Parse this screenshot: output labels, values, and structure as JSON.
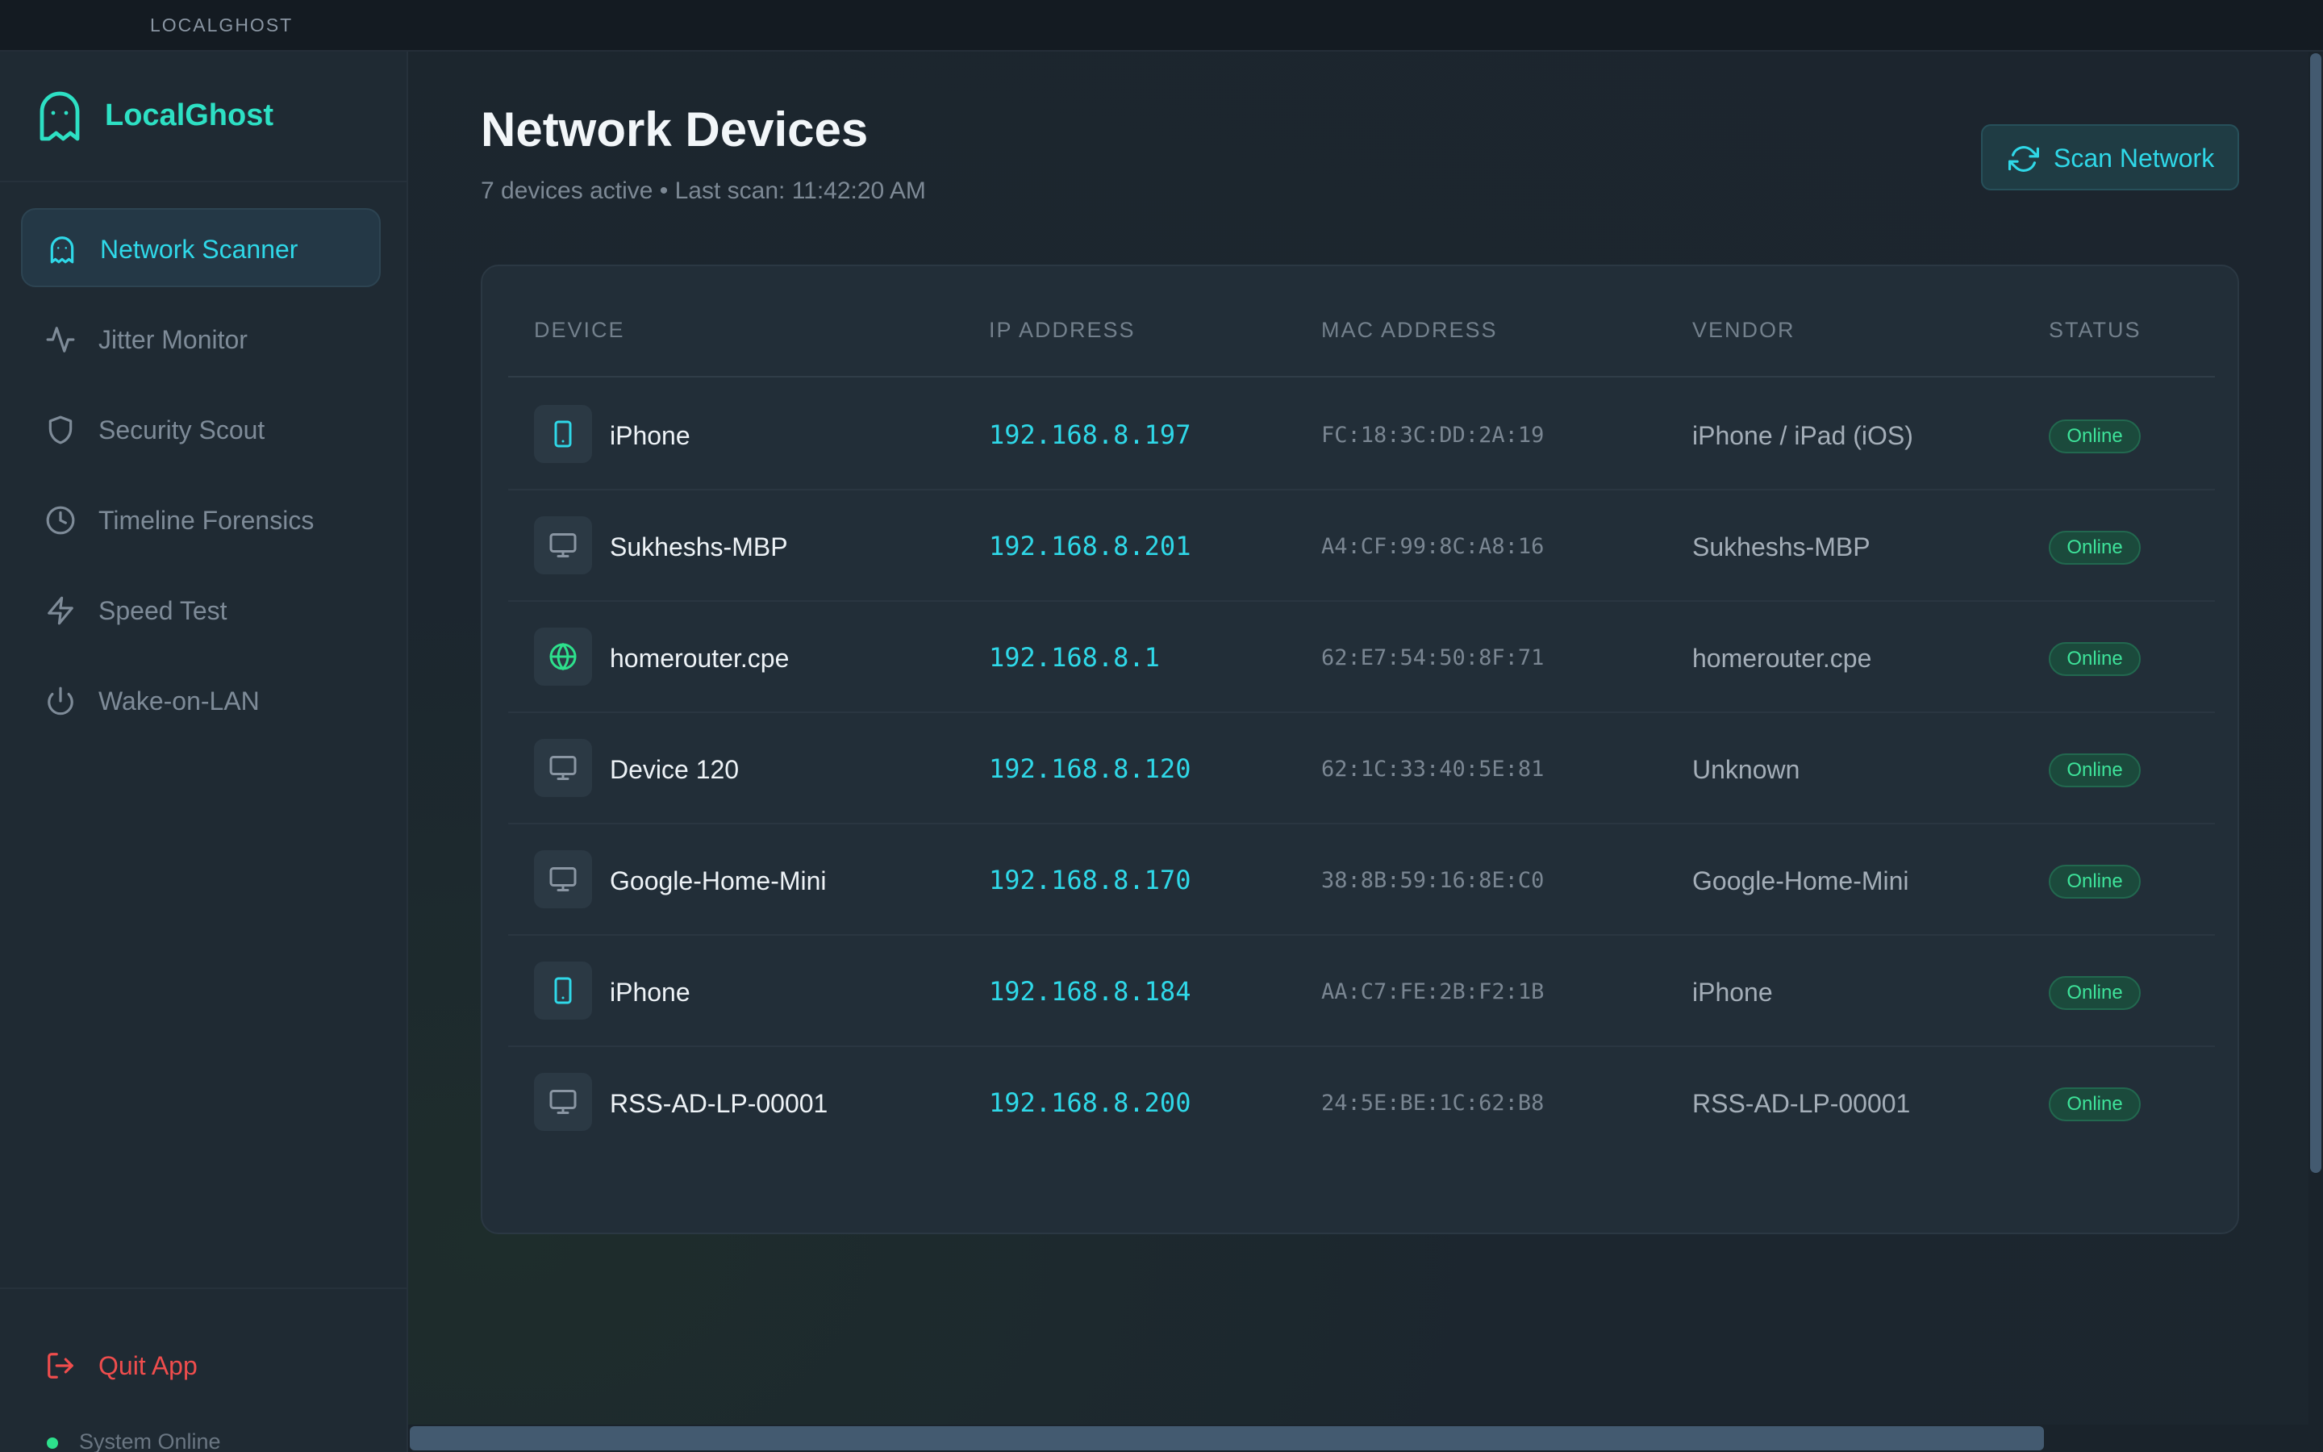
{
  "window": {
    "title": "LOCALGHOST"
  },
  "sidebar": {
    "brand": "LocalGhost",
    "items": [
      {
        "label": "Network Scanner",
        "icon": "ghost-icon",
        "active": true
      },
      {
        "label": "Jitter Monitor",
        "icon": "activity-icon",
        "active": false
      },
      {
        "label": "Security Scout",
        "icon": "shield-icon",
        "active": false
      },
      {
        "label": "Timeline Forensics",
        "icon": "clock-icon",
        "active": false
      },
      {
        "label": "Speed Test",
        "icon": "lightning-icon",
        "active": false
      },
      {
        "label": "Wake-on-LAN",
        "icon": "power-icon",
        "active": false
      }
    ],
    "quit_label": "Quit App",
    "system_status": "System Online"
  },
  "main": {
    "title": "Network Devices",
    "subtitle": "7 devices active • Last scan: 11:42:20 AM",
    "scan_button": "Scan Network",
    "table": {
      "headers": [
        "DEVICE",
        "IP ADDRESS",
        "MAC ADDRESS",
        "VENDOR",
        "STATUS"
      ],
      "rows": [
        {
          "icon": "phone-icon",
          "device": "iPhone",
          "ip": "192.168.8.197",
          "mac": "FC:18:3C:DD:2A:19",
          "vendor": "iPhone / iPad (iOS)",
          "status": "Online"
        },
        {
          "icon": "monitor-icon",
          "device": "Sukheshs-MBP",
          "ip": "192.168.8.201",
          "mac": "A4:CF:99:8C:A8:16",
          "vendor": "Sukheshs-MBP",
          "status": "Online"
        },
        {
          "icon": "globe-icon",
          "device": "homerouter.cpe",
          "ip": "192.168.8.1",
          "mac": "62:E7:54:50:8F:71",
          "vendor": "homerouter.cpe",
          "status": "Online"
        },
        {
          "icon": "monitor-icon",
          "device": "Device 120",
          "ip": "192.168.8.120",
          "mac": "62:1C:33:40:5E:81",
          "vendor": "Unknown",
          "status": "Online"
        },
        {
          "icon": "monitor-icon",
          "device": "Google-Home-Mini",
          "ip": "192.168.8.170",
          "mac": "38:8B:59:16:8E:C0",
          "vendor": "Google-Home-Mini",
          "status": "Online"
        },
        {
          "icon": "phone-icon",
          "device": "iPhone",
          "ip": "192.168.8.184",
          "mac": "AA:C7:FE:2B:F2:1B",
          "vendor": "iPhone",
          "status": "Online"
        },
        {
          "icon": "monitor-icon",
          "device": "RSS-AD-LP-00001",
          "ip": "192.168.8.200",
          "mac": "24:5E:BE:1C:62:B8",
          "vendor": "RSS-AD-LP-00001",
          "status": "Online"
        }
      ]
    }
  },
  "colors": {
    "accent": "#2fd8e8",
    "brand": "#2de0c4",
    "online": "#3ee39a",
    "danger": "#ef4d4d"
  }
}
